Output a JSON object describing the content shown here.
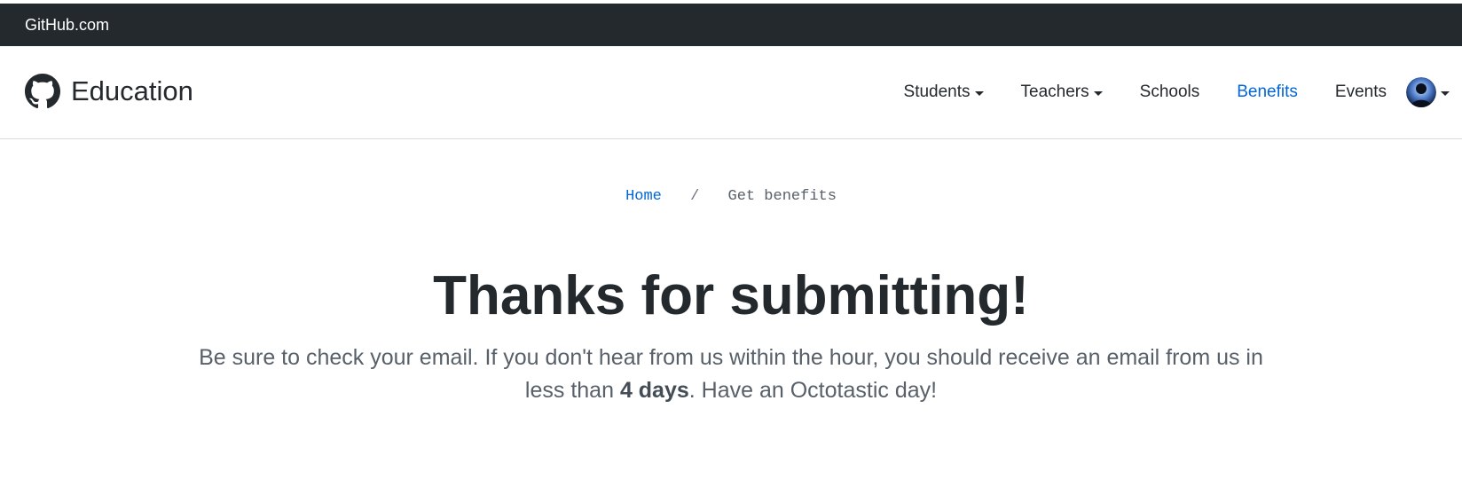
{
  "global_bar": {
    "link_label": "GitHub.com",
    "background": "#24292e"
  },
  "nav": {
    "brand": {
      "icon": "github-octocat-icon",
      "title": "Education"
    },
    "items": [
      {
        "label": "Students",
        "has_dropdown": true,
        "active": false
      },
      {
        "label": "Teachers",
        "has_dropdown": true,
        "active": false
      },
      {
        "label": "Schools",
        "has_dropdown": false,
        "active": false
      },
      {
        "label": "Benefits",
        "has_dropdown": false,
        "active": true
      },
      {
        "label": "Events",
        "has_dropdown": false,
        "active": false
      }
    ],
    "avatar_icon": "user-avatar",
    "avatar_caret_icon": "caret-down-icon",
    "active_color": "#0366d6"
  },
  "breadcrumb": {
    "home": "Home",
    "separator": "/",
    "current": "Get benefits"
  },
  "main": {
    "headline": "Thanks for submitting!",
    "message_part1": "Be sure to check your email. If you don't hear from us within the hour, you should receive an email from us in less than ",
    "message_bold": "4 days",
    "message_part2": ". Have an Octotastic day!"
  }
}
